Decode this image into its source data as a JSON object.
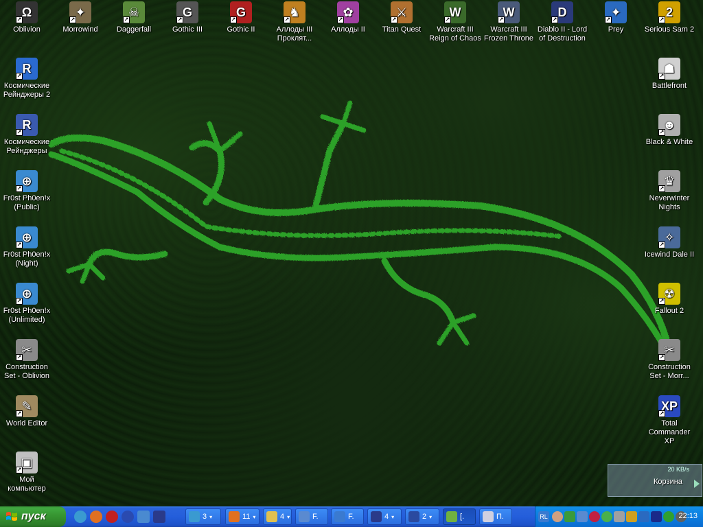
{
  "desktop": {
    "icons_top": [
      {
        "name": "Oblivion",
        "label": "Oblivion",
        "color": "#333333",
        "glyph": "Ω"
      },
      {
        "name": "Morrowind",
        "label": "Morrowind",
        "color": "#7a6a4a",
        "glyph": "✦"
      },
      {
        "name": "Daggerfall",
        "label": "Daggerfall",
        "color": "#5a8a3a",
        "glyph": "☠"
      },
      {
        "name": "Gothic-III",
        "label": "Gothic III",
        "color": "#555555",
        "glyph": "G"
      },
      {
        "name": "Gothic-II",
        "label": "Gothic II",
        "color": "#b02020",
        "glyph": "G"
      },
      {
        "name": "Allods-III",
        "label": "Аллоды III Проклят...",
        "color": "#c08020",
        "glyph": "♞"
      },
      {
        "name": "Allods-II",
        "label": "Аллоды II",
        "color": "#a040a0",
        "glyph": "✿"
      },
      {
        "name": "Titan-Quest",
        "label": "Titan Quest",
        "color": "#b07030",
        "glyph": "⚔"
      },
      {
        "name": "Warcraft-III-RoC",
        "label": "Warcraft III Reign of Chaos",
        "color": "#3a6a2a",
        "glyph": "W"
      },
      {
        "name": "Warcraft-III-TFT",
        "label": "Warcraft III Frozen Throne",
        "color": "#4a5a7a",
        "glyph": "W"
      },
      {
        "name": "Diablo-II-LoD",
        "label": "Diablo II - Lord of Destruction",
        "color": "#2a3a7a",
        "glyph": "D"
      },
      {
        "name": "Prey",
        "label": "Prey",
        "color": "#2a6ac0",
        "glyph": "✦"
      },
      {
        "name": "Serious-Sam-2",
        "label": "Serious Sam 2",
        "color": "#d0a000",
        "glyph": "2"
      }
    ],
    "icons_left": [
      {
        "name": "space-rangers-2",
        "label": "Космические Рейнджеры 2",
        "color": "#2a6ad0",
        "glyph": "R"
      },
      {
        "name": "space-rangers",
        "label": "Космические Рейнджеры",
        "color": "#3a5ab0",
        "glyph": "R"
      },
      {
        "name": "frost-phoenix-public",
        "label": "Fr0st Ph0en!x (Public)",
        "color": "#3a8ad0",
        "glyph": "⊕"
      },
      {
        "name": "frost-phoenix-night",
        "label": "Fr0st Ph0en!x (Night)",
        "color": "#3a8ad0",
        "glyph": "⊕"
      },
      {
        "name": "frost-phoenix-unlimited",
        "label": "Fr0st Ph0en!x (Unlimited)",
        "color": "#3a8ad0",
        "glyph": "⊕"
      },
      {
        "name": "construction-set-oblivion",
        "label": "Construction Set - Oblivion",
        "color": "#8a8a8a",
        "glyph": "✂"
      },
      {
        "name": "world-editor",
        "label": "World Editor",
        "color": "#a08a60",
        "glyph": "✎"
      },
      {
        "name": "my-computer",
        "label": "Мой компьютер",
        "color": "#c0c0c0",
        "glyph": "▣"
      }
    ],
    "icons_right": [
      {
        "name": "battlefront",
        "label": "Battlefront",
        "color": "#d0d0d0",
        "glyph": "☗"
      },
      {
        "name": "black-and-white",
        "label": "Black & White",
        "color": "#b0b0b0",
        "glyph": "☻"
      },
      {
        "name": "neverwinter-nights",
        "label": "Neverwinter Nights",
        "color": "#a0a0a0",
        "glyph": "♛"
      },
      {
        "name": "icewind-dale-ii",
        "label": "Icewind Dale II",
        "color": "#4a6a9a",
        "glyph": "✧"
      },
      {
        "name": "fallout-2",
        "label": "Fallout 2",
        "color": "#d0c000",
        "glyph": "☢"
      },
      {
        "name": "construction-set-morrowind",
        "label": "Construction Set - Morr...",
        "color": "#8a8a8a",
        "glyph": "✂"
      },
      {
        "name": "total-commander-xp",
        "label": "Total Commander XP",
        "color": "#2a4ac0",
        "glyph": "XP"
      }
    ]
  },
  "netmeter": {
    "speed": "20 KB/s",
    "recycle_label": "Корзина"
  },
  "taskbar": {
    "start_label": "пуск",
    "tasks": [
      {
        "name": "task-ie",
        "label": "3",
        "color": "#3a9ad0",
        "caret": "▾"
      },
      {
        "name": "task-firefox",
        "label": "11",
        "color": "#e07020",
        "caret": "▾"
      },
      {
        "name": "task-folders",
        "label": "4",
        "color": "#e0c050",
        "caret": "▾"
      },
      {
        "name": "task-f1",
        "label": "F.",
        "color": "#5a8ad0",
        "caret": ""
      },
      {
        "name": "task-f2",
        "label": "F.",
        "color": "#3a7ad0",
        "caret": ""
      },
      {
        "name": "task-save",
        "label": "4",
        "color": "#2a3a8a",
        "caret": "▾"
      },
      {
        "name": "task-word",
        "label": "2",
        "color": "#2a4aa0",
        "caret": "▾"
      },
      {
        "name": "task-notes",
        "label": "[.",
        "color": "#70b040",
        "caret": ""
      },
      {
        "name": "task-player",
        "label": "П.",
        "color": "#d0d0e0",
        "caret": ""
      }
    ],
    "clock": "22:13"
  },
  "colors": {
    "taskbar": "#245edb",
    "start": "#35922f",
    "tray": "#0c7de0",
    "lizard": "#2fa82a"
  }
}
